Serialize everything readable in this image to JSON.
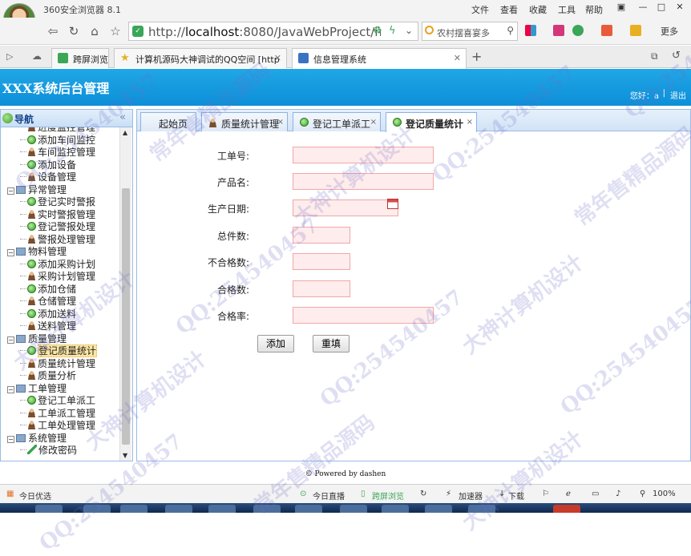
{
  "browser": {
    "name": "360安全浏览器 8.1",
    "menu": [
      "文件",
      "查看",
      "收藏",
      "工具",
      "帮助"
    ],
    "url_prefix": "http://",
    "url_host": "localhost",
    "url_rest": ":8080/JavaWebProject/main.j",
    "search_text": "农村摆喜宴多",
    "more_label": "更多",
    "tabs": [
      {
        "label": "跨屏浏览"
      },
      {
        "label": "计算机源码大神调试的QQ空间 [http"
      },
      {
        "label": "信息管理系统"
      }
    ]
  },
  "app": {
    "title": "XXX系统后台管理",
    "user_text": "您好：a",
    "logout_label": "退出"
  },
  "nav": {
    "title": "导航",
    "items": [
      {
        "label": "进度监控管理",
        "icon": "user-icon",
        "level": 2
      },
      {
        "label": "添加车间监控",
        "icon": "add-icon",
        "level": 2
      },
      {
        "label": "车间监控管理",
        "icon": "user-icon",
        "level": 2
      },
      {
        "label": "添加设备",
        "icon": "add-icon",
        "level": 2
      },
      {
        "label": "设备管理",
        "icon": "user-icon",
        "level": 2
      },
      {
        "label": "异常管理",
        "icon": "folder-icon",
        "level": 1
      },
      {
        "label": "登记实时警报",
        "icon": "add-icon",
        "level": 2
      },
      {
        "label": "实时警报管理",
        "icon": "user-icon",
        "level": 2
      },
      {
        "label": "登记警报处理",
        "icon": "add-icon",
        "level": 2
      },
      {
        "label": "警报处理管理",
        "icon": "user-icon",
        "level": 2
      },
      {
        "label": "物料管理",
        "icon": "folder-icon",
        "level": 1
      },
      {
        "label": "添加采购计划",
        "icon": "add-icon",
        "level": 2
      },
      {
        "label": "采购计划管理",
        "icon": "user-icon",
        "level": 2
      },
      {
        "label": "添加仓储",
        "icon": "add-icon",
        "level": 2
      },
      {
        "label": "仓储管理",
        "icon": "user-icon",
        "level": 2
      },
      {
        "label": "添加送料",
        "icon": "add-icon",
        "level": 2
      },
      {
        "label": "送料管理",
        "icon": "user-icon",
        "level": 2
      },
      {
        "label": "质量管理",
        "icon": "folder-icon",
        "level": 1
      },
      {
        "label": "登记质量统计",
        "icon": "add-icon",
        "level": 2,
        "selected": true
      },
      {
        "label": "质量统计管理",
        "icon": "user-icon",
        "level": 2
      },
      {
        "label": "质量分析",
        "icon": "user-icon",
        "level": 2
      },
      {
        "label": "工单管理",
        "icon": "folder-icon",
        "level": 1
      },
      {
        "label": "登记工单派工",
        "icon": "add-icon",
        "level": 2
      },
      {
        "label": "工单派工管理",
        "icon": "user-icon",
        "level": 2
      },
      {
        "label": "工单处理管理",
        "icon": "user-icon",
        "level": 2
      },
      {
        "label": "系统管理",
        "icon": "folder-icon",
        "level": 1
      },
      {
        "label": "修改密码",
        "icon": "pencil-icon",
        "level": 2
      }
    ]
  },
  "content_tabs": [
    {
      "label": "起始页",
      "closable": false
    },
    {
      "label": "质量统计管理",
      "closable": true
    },
    {
      "label": "登记工单派工",
      "closable": true
    },
    {
      "label": "登记质量统计",
      "closable": true,
      "active": true
    }
  ],
  "form": {
    "fields": [
      {
        "label": "工单号:",
        "value": ""
      },
      {
        "label": "产品名:",
        "value": ""
      },
      {
        "label": "生产日期:",
        "value": ""
      },
      {
        "label": "总件数:",
        "value": ""
      },
      {
        "label": "不合格数:",
        "value": ""
      },
      {
        "label": "合格数:",
        "value": ""
      },
      {
        "label": "合格率:",
        "value": ""
      }
    ],
    "add_button": "添加",
    "reset_button": "重填"
  },
  "footer": "© Powered by dashen",
  "statusbar": {
    "left": "今日优选",
    "items": [
      "今日直播",
      "跨屏浏览",
      "加速器",
      "下载"
    ],
    "zoom": "100%"
  },
  "watermark": [
    "QQ:254540457",
    "大神计算机设计",
    "常年售精品源码"
  ],
  "colors": {
    "header_blue": "#0c8fd8",
    "nav_border": "#99bbe8",
    "input_bg": "#ffecec",
    "input_border": "#f1a7a7",
    "selected_bg": "#fde6a4"
  }
}
